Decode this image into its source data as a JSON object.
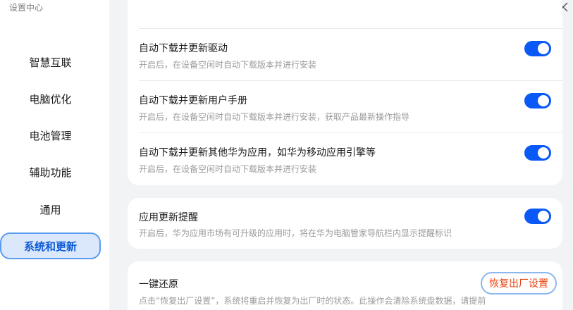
{
  "app": {
    "title": "设置中心"
  },
  "sidebar": {
    "items": [
      {
        "label": "智慧互联",
        "active": false
      },
      {
        "label": "电脑优化",
        "active": false
      },
      {
        "label": "电池管理",
        "active": false
      },
      {
        "label": "辅助功能",
        "active": false
      },
      {
        "label": "通用",
        "active": false
      },
      {
        "label": "系统和更新",
        "active": true
      }
    ]
  },
  "window": {
    "close_icon": "close-icon"
  },
  "updates_card": {
    "rows": [
      {
        "title": "自动下载并更新驱动",
        "desc": "开启后，在设备空闲时自动下载版本并进行安装",
        "enabled": true
      },
      {
        "title": "自动下载并更新用户手册",
        "desc": "开启后，在设备空闲时自动下载版本并进行安装，获取产品最新操作指导",
        "enabled": true
      },
      {
        "title": "自动下载并更新其他华为应用，如华为移动应用引擎等",
        "desc": "开启后，在设备空闲时自动下载版本并进行安装",
        "enabled": true
      }
    ]
  },
  "reminder_card": {
    "title": "应用更新提醒",
    "desc": "开启后，华为应用市场有可升级的应用时，将在华为电脑管家导航栏内显示提醒标识",
    "enabled": true
  },
  "reset_card": {
    "title": "一键还原",
    "button_label": "恢复出厂设置",
    "desc": "点击“恢复出厂设置”，系统将重启并恢复为出厂时的状态。此操作会清除系统盘数据，请提前做好备份，避免文件丢失。"
  },
  "colors": {
    "accent": "#0a59f7",
    "danger": "#e8400c",
    "active_nav_bg": "#dbe8fb"
  }
}
